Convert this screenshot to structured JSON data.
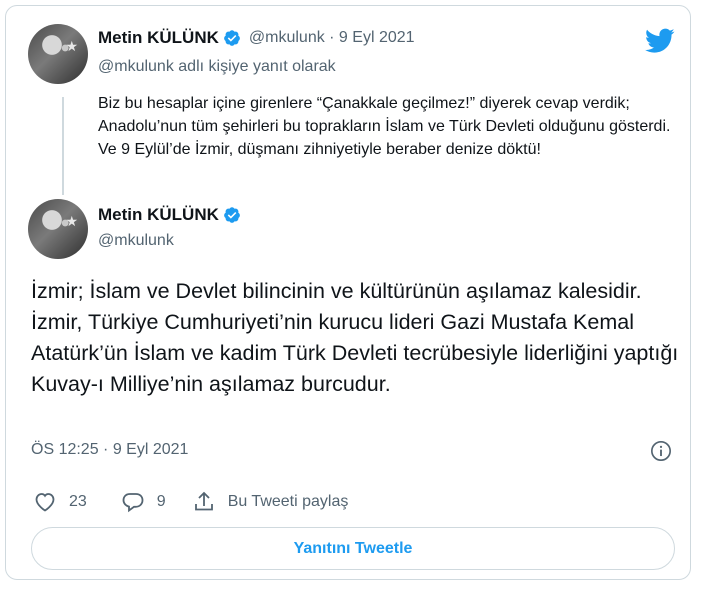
{
  "colors": {
    "accent": "#1d9bf0",
    "text": "#0f1419",
    "muted": "#536471",
    "border": "#cfd9de"
  },
  "parent_tweet": {
    "author_name": "Metin KÜLÜNK",
    "handle_and_date": "@mkulunk · 9 Eyl 2021",
    "replying_to": "@mkulunk adlı kişiye yanıt olarak",
    "text": "Biz bu hesaplar içine girenlere “Çanakkale geçilmez!” diyerek cevap verdik; Anadolu’nun tüm şehirleri bu toprakların İslam ve Türk Devleti olduğunu gösterdi. Ve 9 Eylül’de İzmir, düşmanı zihniyetiyle beraber denize döktü!"
  },
  "main_tweet": {
    "author_name": "Metin KÜLÜNK",
    "handle": "@mkulunk",
    "text": "İzmir; İslam ve Devlet bilincinin ve kültürünün aşılamaz kalesidir. İzmir, Türkiye Cumhuriyeti’nin kurucu lideri Gazi Mustafa Kemal Atatürk’ün İslam ve kadim Türk Devleti tecrübesiyle liderliğini yaptığı Kuvay-ı Milliye’nin aşılamaz burcudur.",
    "timestamp": "ÖS 12:25 · 9 Eyl 2021"
  },
  "actions": {
    "likes": "23",
    "replies": "9",
    "share_label": "Bu Tweeti paylaş"
  },
  "reply_button_label": "Yanıtını Tweetle",
  "icons": [
    "twitter-logo-icon",
    "verified-badge-icon",
    "info-icon",
    "heart-icon",
    "reply-bubble-icon",
    "share-icon"
  ]
}
